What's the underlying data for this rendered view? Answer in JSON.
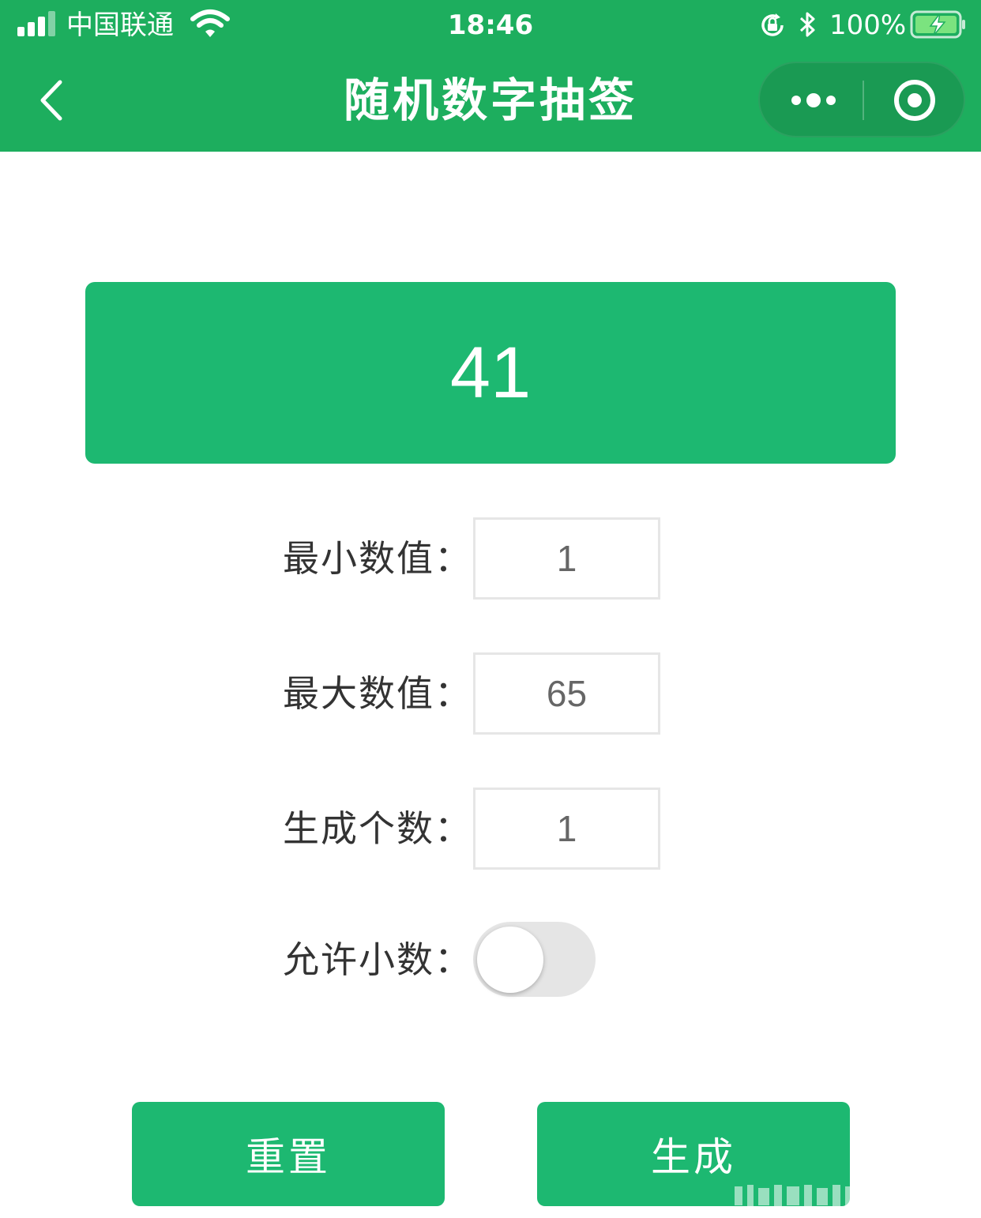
{
  "status_bar": {
    "carrier": "中国联通",
    "time": "18:46",
    "battery": "100%"
  },
  "nav": {
    "title": "随机数字抽签"
  },
  "result": {
    "value": "41"
  },
  "form": {
    "min_label": "最小数值：",
    "min_value": "1",
    "max_label": "最大数值：",
    "max_value": "65",
    "count_label": "生成个数：",
    "count_value": "1",
    "decimal_label": "允许小数：",
    "decimal_enabled": false
  },
  "buttons": {
    "reset": "重置",
    "generate": "生成"
  },
  "colors": {
    "header": "#1dae5e",
    "accent": "#1db871"
  }
}
